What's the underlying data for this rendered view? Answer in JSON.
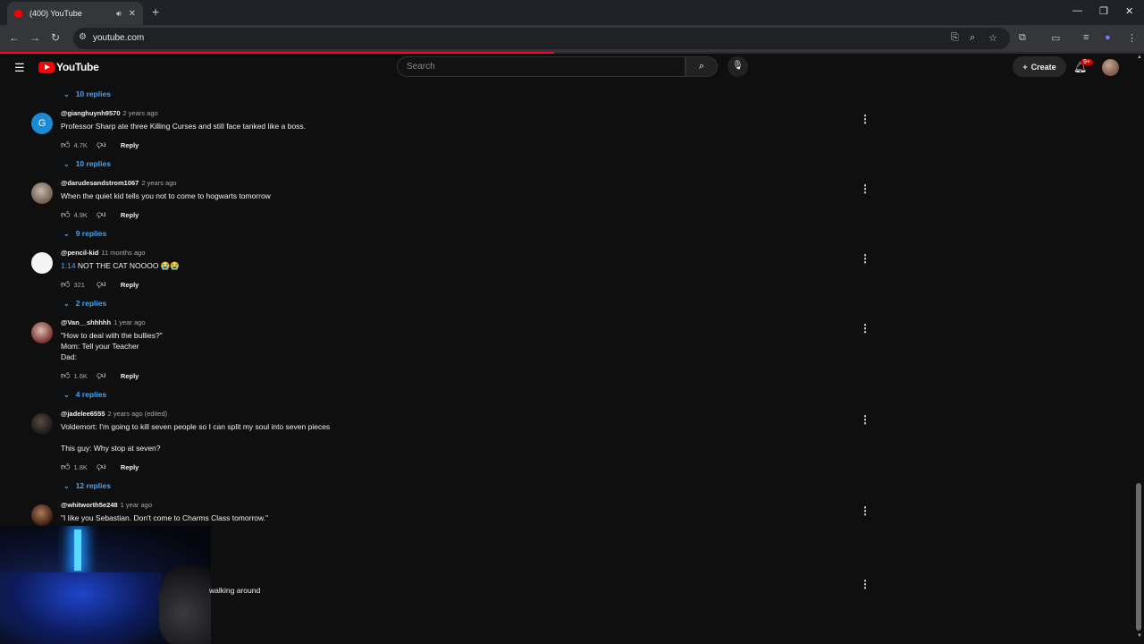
{
  "browser": {
    "tab_title": "(400) YouTube",
    "url": "youtube.com"
  },
  "header": {
    "logo_text": "YouTube",
    "search_placeholder": "Search",
    "create_label": "Create",
    "notification_count": "9+"
  },
  "comments": {
    "first_replies": "10 replies",
    "items": [
      {
        "handle": "@gianghuynh9570",
        "time": "2 years ago",
        "body": "Professor Sharp ate three Killing Curses and still face tanked like a boss.",
        "likes": "4.7K",
        "reply_label": "Reply",
        "replies": "10 replies",
        "avatar_letter": "G",
        "avatar_color": "#1a8bd6"
      },
      {
        "handle": "@darudesandstrom1067",
        "time": "2 years ago",
        "body": "When the quiet kid tells you not to come to hogwarts tomorrow",
        "likes": "4.9K",
        "reply_label": "Reply",
        "replies": "9 replies"
      },
      {
        "handle": "@pencil-kid",
        "time": "11 months ago",
        "timestamp_link": "1:14",
        "body": " NOT THE CAT NOOOO 😭😭",
        "likes": "321",
        "reply_label": "Reply",
        "replies": "2 replies"
      },
      {
        "handle": "@Van__shhhhh",
        "time": "1 year ago",
        "body": "\"How to deal with the bullies?\"\nMom: Tell your Teacher\nDad:",
        "likes": "1.6K",
        "reply_label": "Reply",
        "replies": "4 replies"
      },
      {
        "handle": "@jadelee6555",
        "time": "2 years ago (edited)",
        "body": "Voldemort: I'm going to kill seven people so I can split my soul into seven pieces\n\nThis guy: Why stop at seven?",
        "likes": "1.8K",
        "reply_label": "Reply",
        "replies": "12 replies"
      },
      {
        "handle": "@whitworth5e248",
        "time": "1 year ago",
        "body": "\"I like you Sebastian. Don't come to Charms Class tomorrow.\""
      }
    ],
    "partial_text": "walking around"
  },
  "icons": {
    "menu": "hamburger-icon",
    "search": "search-icon",
    "mic": "mic-icon",
    "bell": "bell-icon",
    "like": "thumbs-up-icon",
    "dislike": "thumbs-down-icon",
    "more": "more-vert-icon"
  },
  "colors": {
    "background": "#0f0f0f",
    "link": "#3ea6ff",
    "brand": "#ff0000"
  }
}
